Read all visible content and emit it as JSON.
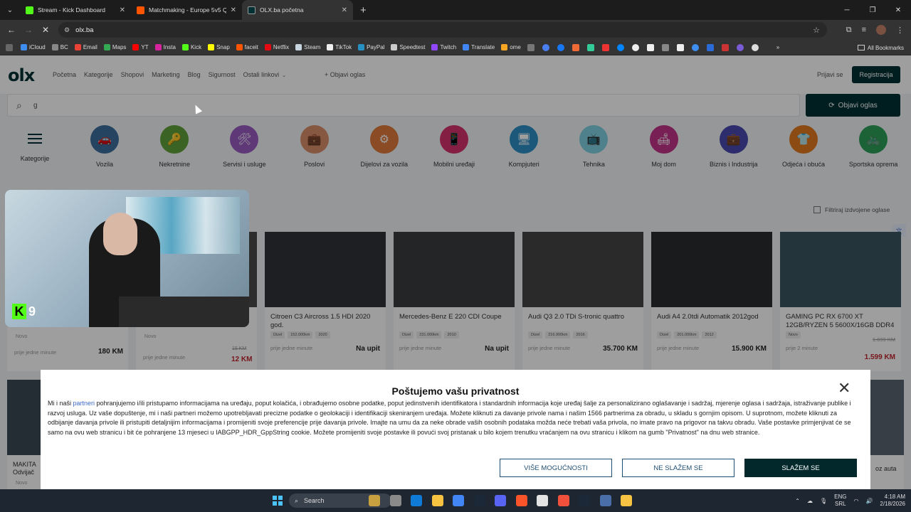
{
  "browser": {
    "tabs": [
      {
        "title": "Stream - Kick Dashboard",
        "color": "#53fc18",
        "active": false
      },
      {
        "title": "Matchmaking - Europe 5v5 Que",
        "color": "#ff5500",
        "active": false
      },
      {
        "title": "OLX.ba početna",
        "color": "#002f34",
        "active": true
      }
    ],
    "url": "olx.ba",
    "bookmarks": [
      "iCloud",
      "BC",
      "Email",
      "Maps",
      "YT",
      "Insta",
      "Kick",
      "Snap",
      "faceit",
      "Netflix",
      "Steam",
      "TikTok",
      "PayPal",
      "Speedtest",
      "Twitch",
      "Translate",
      "ome"
    ],
    "all_bookmarks": "All Bookmarks"
  },
  "header": {
    "logo": "olx",
    "nav": [
      "Početna",
      "Kategorije",
      "Shopovi",
      "Marketing",
      "Blog",
      "Sigurnost"
    ],
    "nav_more": "Ostali linkovi",
    "post_ad": "Objavi oglas",
    "login": "Prijavi se",
    "register": "Registracija"
  },
  "search": {
    "value": "g",
    "button": "Objavi oglas"
  },
  "categories": [
    {
      "label": "Kategorije",
      "color": "#002f34"
    },
    {
      "label": "Vozila",
      "color": "#3d6f9e"
    },
    {
      "label": "Nekretnine",
      "color": "#5fa13a"
    },
    {
      "label": "Servisi i usluge",
      "color": "#9a5bc2"
    },
    {
      "label": "Poslovi",
      "color": "#d98f6a"
    },
    {
      "label": "Dijelovi za vozila",
      "color": "#e07a3a"
    },
    {
      "label": "Mobilni uređaji",
      "color": "#d6336c"
    },
    {
      "label": "Kompjuteri",
      "color": "#2d8fc5"
    },
    {
      "label": "Tehnika",
      "color": "#7fd1e0"
    },
    {
      "label": "Moj dom",
      "color": "#c2338a"
    },
    {
      "label": "Biznis i Industrija",
      "color": "#4a4ab0"
    },
    {
      "label": "Odjeća i obuća",
      "color": "#e07a20"
    },
    {
      "label": "Sportska oprema",
      "color": "#2e9e5a"
    }
  ],
  "filter": "Filtriraj izdvojene oglase",
  "listings": [
    {
      "title": "Citroen C3 Aircross 1.5 HDI 2020 god.",
      "chips": [
        "Dizel",
        "152.000km",
        "2020"
      ],
      "time": "prije jedne minute",
      "price": "Na upit",
      "img": "#2f3337"
    },
    {
      "title": "Mercedes-Benz E 220 CDI Coupe",
      "chips": [
        "Dizel",
        "231.000km",
        "2010"
      ],
      "time": "prije jedne minute",
      "price": "Na upit",
      "img": "#3a3c3e"
    },
    {
      "title": "Audi Q3 2.0 TDi S-tronic quattro",
      "chips": [
        "Dizel",
        "216.900km",
        "2016"
      ],
      "time": "prije jedne minute",
      "price": "35.700 KM",
      "img": "#444"
    },
    {
      "title": "Audi A4 2.0tdi Automatik 2012god",
      "chips": [
        "Dizel",
        "201.000km",
        "2012"
      ],
      "time": "prije jedne minute",
      "price": "15.900 KM",
      "img": "#2a2c2e"
    },
    {
      "title": "GAMING PC RX 6700 XT 12GB/RYZEN 5 5600X/16GB DDR4",
      "chips": [
        "Novo"
      ],
      "time": "prije 2 minute",
      "price": "1.599 KM",
      "old_price": "1.699 KM",
      "img": "#3b5560"
    }
  ],
  "left_listings": {
    "price1": "180 KM",
    "old_price2": "15 KM",
    "price2": "12 KM",
    "time": "prije jedne minute",
    "novo": "Novo"
  },
  "row2": {
    "title_left": "MAKITA",
    "title_left2": "Odvijač",
    "novo": "Novo",
    "right_text": "oz auta"
  },
  "stream": {
    "badge": "9"
  },
  "privacy": {
    "title": "Poštujemo vašu privatnost",
    "text_before_link": "Mi i naši ",
    "link": "partneri",
    "text_after_link": " pohranjujemo i/ili pristupamo informacijama na uređaju, poput kolačića, i obrađujemo osobne podatke, poput jedinstvenih identifikatora i standardnih informacija koje uređaj šalje za personalizirano oglašavanje i sadržaj, mjerenje oglasa i sadržaja, istraživanje publike i razvoj usluga. Uz vaše dopuštenje, mi i naši partneri možemo upotrebljavati precizne podatke o geolokaciji i identifikaciji skeniranjem uređaja. Možete kliknuti za davanje privole nama i našim 1566 partnerima za obradu, u skladu s gornjim opisom. U suprotnom, možete kliknuti za odbijanje davanja privole ili pristupiti detaljnijim informacijama i promijeniti svoje preferencije prije davanja privole. Imajte na umu da za neke obrade vaših osobnih podataka možda neće trebati vaša privola, no imate pravo na prigovor na takvu obradu. Vaše postavke primjenjivat će se samo na ovu web stranicu i bit će pohranjene 13 mjeseci u IABGPP_HDR_GppString cookie. Možete promijeniti svoje postavke ili povući svoj pristanak u bilo kojem trenutku vraćanjem na ovu stranicu i klikom na gumb \"Privatnost\" na dnu web stranice.",
    "btn_more": "VIŠE MOGUĆNOSTI",
    "btn_decline": "NE SLAŽEM SE",
    "btn_accept": "SLAŽEM SE"
  },
  "taskbar": {
    "search": "Search",
    "lang1": "ENG",
    "lang2": "SRL",
    "time": "4:18 AM",
    "date": "2/18/2026",
    "icon_colors": [
      "#c8a040",
      "#8a8a8a",
      "#0f7bd7",
      "#f5c242",
      "#4285f4",
      "#1b2838",
      "#5865f2",
      "#fb542b",
      "#e3e3e3",
      "#f0503c",
      "#1b2838",
      "#4a6ea8",
      "#f5c242"
    ]
  }
}
